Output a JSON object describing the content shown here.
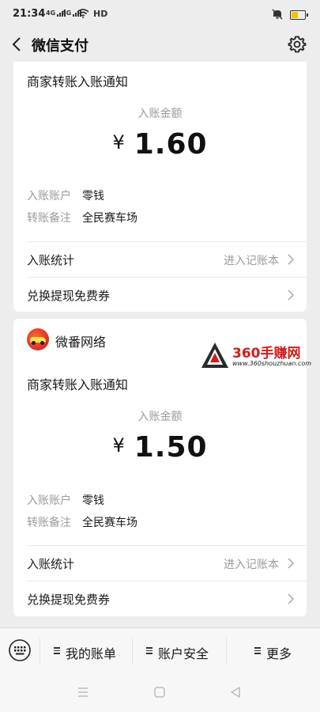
{
  "status_bar": {
    "time": "21:34",
    "signal1_label": "4G",
    "signal2_label": "4G",
    "network": "HD",
    "icons": [
      "signal-icon",
      "wifi-icon",
      "mute-icon",
      "battery-icon"
    ]
  },
  "nav": {
    "title": "微信支付",
    "back_icon": "back-chevron-icon",
    "settings_icon": "gear-icon"
  },
  "notifications": [
    {
      "title": "商家转账入账通知",
      "amount_label": "入账金额",
      "currency": "¥",
      "amount": "1.60",
      "details": [
        {
          "key": "入账账户",
          "value": "零钱"
        },
        {
          "key": "转账备注",
          "value": "全民赛车场"
        }
      ],
      "actions": [
        {
          "label": "入账统计",
          "hint": "进入记账本"
        },
        {
          "label": "兑换提现免费券",
          "hint": ""
        }
      ]
    },
    {
      "merchant": "微番网络",
      "title": "商家转账入账通知",
      "amount_label": "入账金额",
      "currency": "¥",
      "amount": "1.50",
      "details": [
        {
          "key": "入账账户",
          "value": "零钱"
        },
        {
          "key": "转账备注",
          "value": "全民赛车场"
        }
      ],
      "actions": [
        {
          "label": "入账统计",
          "hint": "进入记账本"
        },
        {
          "label": "兑换提现免费券",
          "hint": ""
        }
      ]
    }
  ],
  "watermark": {
    "brand": "360手赚网",
    "url": "www.360shouzhuan.com"
  },
  "bottom_menu": {
    "keyboard_icon": "keyboard-icon",
    "items": [
      "我的账单",
      "账户安全",
      "更多"
    ]
  },
  "android_nav": [
    "menu-icon",
    "home-icon",
    "back-icon"
  ],
  "colors": {
    "background": "#ededed",
    "card": "#ffffff",
    "muted_text": "#9a9a9a",
    "watermark_red": "#d31b1b"
  }
}
